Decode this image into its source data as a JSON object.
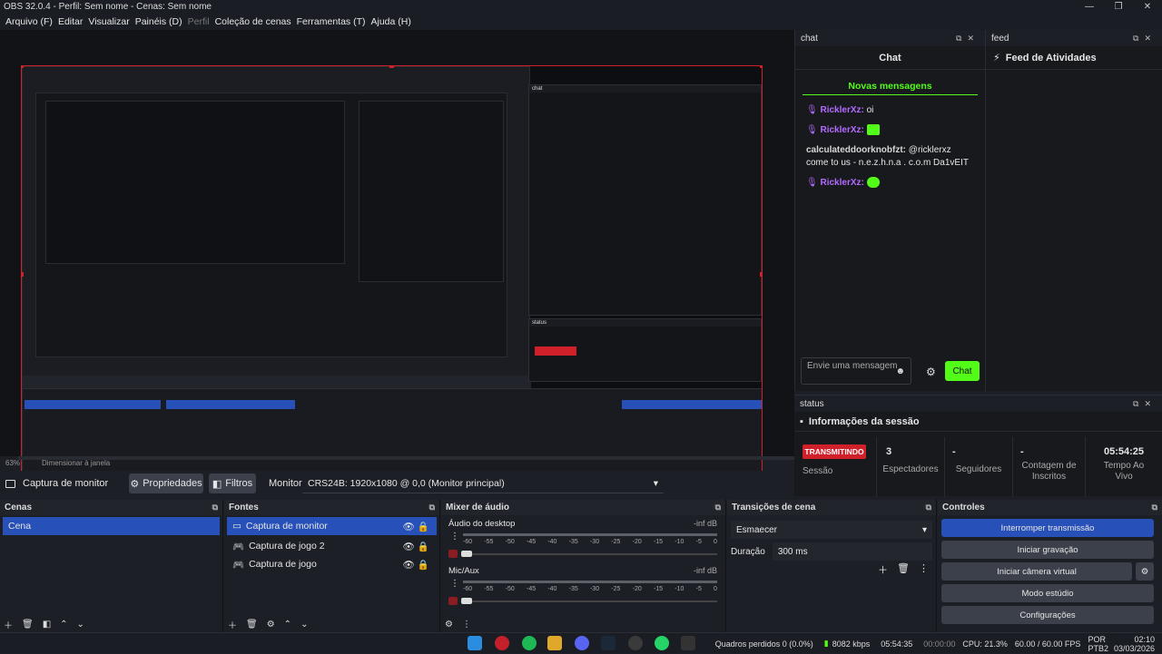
{
  "window": {
    "title": "OBS 32.0.4 - Perfil: Sem nome - Cenas: Sem nome"
  },
  "menu": [
    "Arquivo (F)",
    "Editar",
    "Visualizar",
    "Painéis (D)",
    "Perfil",
    "Coleção de cenas",
    "Ferramentas (T)",
    "Ajuda (H)"
  ],
  "preview": {
    "zoom": "63%",
    "resize_label": "Dimensionar à janela"
  },
  "source_bar": {
    "source_name": "Captura de monitor",
    "properties": "Propriedades",
    "filters": "Filtros",
    "monitor_label": "Monitor",
    "monitor_value": "CRS24B: 1920x1080 @ 0,0 (Monitor principal)"
  },
  "chat_dock": {
    "header": "chat",
    "title": "Chat",
    "new_messages": "Novas mensagens",
    "messages": [
      {
        "user": "RicklerXz:",
        "text": "oi"
      },
      {
        "user": "RicklerXz:",
        "text": ""
      },
      {
        "user": "calculateddoorknobfzt:",
        "text": "@ricklerxz come to us - n.e.z.h.n.a . c.o.m Da1vEIT"
      },
      {
        "user": "RicklerXz:",
        "text": ""
      }
    ],
    "input_placeholder": "Envie uma mensagem",
    "send": "Chat"
  },
  "feed_dock": {
    "header": "feed",
    "title": "Feed de Atividades"
  },
  "status_dock": {
    "header": "status",
    "title": "Informações da sessão",
    "live_badge": "TRANSMITINDO",
    "stats": [
      {
        "value": "",
        "label": "Sessão"
      },
      {
        "value": "3",
        "label": "Espectadores"
      },
      {
        "value": "-",
        "label": "Seguidores"
      },
      {
        "value": "-",
        "label": "Contagem de Inscritos"
      },
      {
        "value": "05:54:25",
        "label": "Tempo Ao Vivo"
      }
    ]
  },
  "scenes": {
    "header": "Cenas",
    "items": [
      "Cena"
    ]
  },
  "sources": {
    "header": "Fontes",
    "items": [
      "Captura de monitor",
      "Captura de jogo 2",
      "Captura de jogo"
    ]
  },
  "mixer": {
    "header": "Mixer de áudio",
    "channels": [
      {
        "name": "Áudio do desktop",
        "level": "-inf dB"
      },
      {
        "name": "Mic/Aux",
        "level": "-inf dB"
      }
    ],
    "ticks": [
      "-60",
      "-55",
      "-50",
      "-45",
      "-40",
      "-35",
      "-30",
      "-25",
      "-20",
      "-15",
      "-10",
      "-5",
      "0"
    ]
  },
  "transitions": {
    "header": "Transições de cena",
    "type": "Esmaecer",
    "duration_label": "Duração",
    "duration_value": "300 ms"
  },
  "controls": {
    "header": "Controles",
    "buttons": [
      "Interromper transmissão",
      "Iniciar gravação",
      "Iniciar câmera virtual",
      "Modo estúdio",
      "Configurações"
    ]
  },
  "statusbar": {
    "dropped": "Quadros perdidos 0 (0.0%)",
    "bitrate": "8082 kbps",
    "stream_time": "05:54:35",
    "rec_time": "00:00:00",
    "cpu": "CPU: 21.3%",
    "fps": "60.00 / 60.00 FPS",
    "lang": "POR",
    "lang2": "PTB2",
    "clock": "02:10",
    "date": "03/03/2026"
  }
}
